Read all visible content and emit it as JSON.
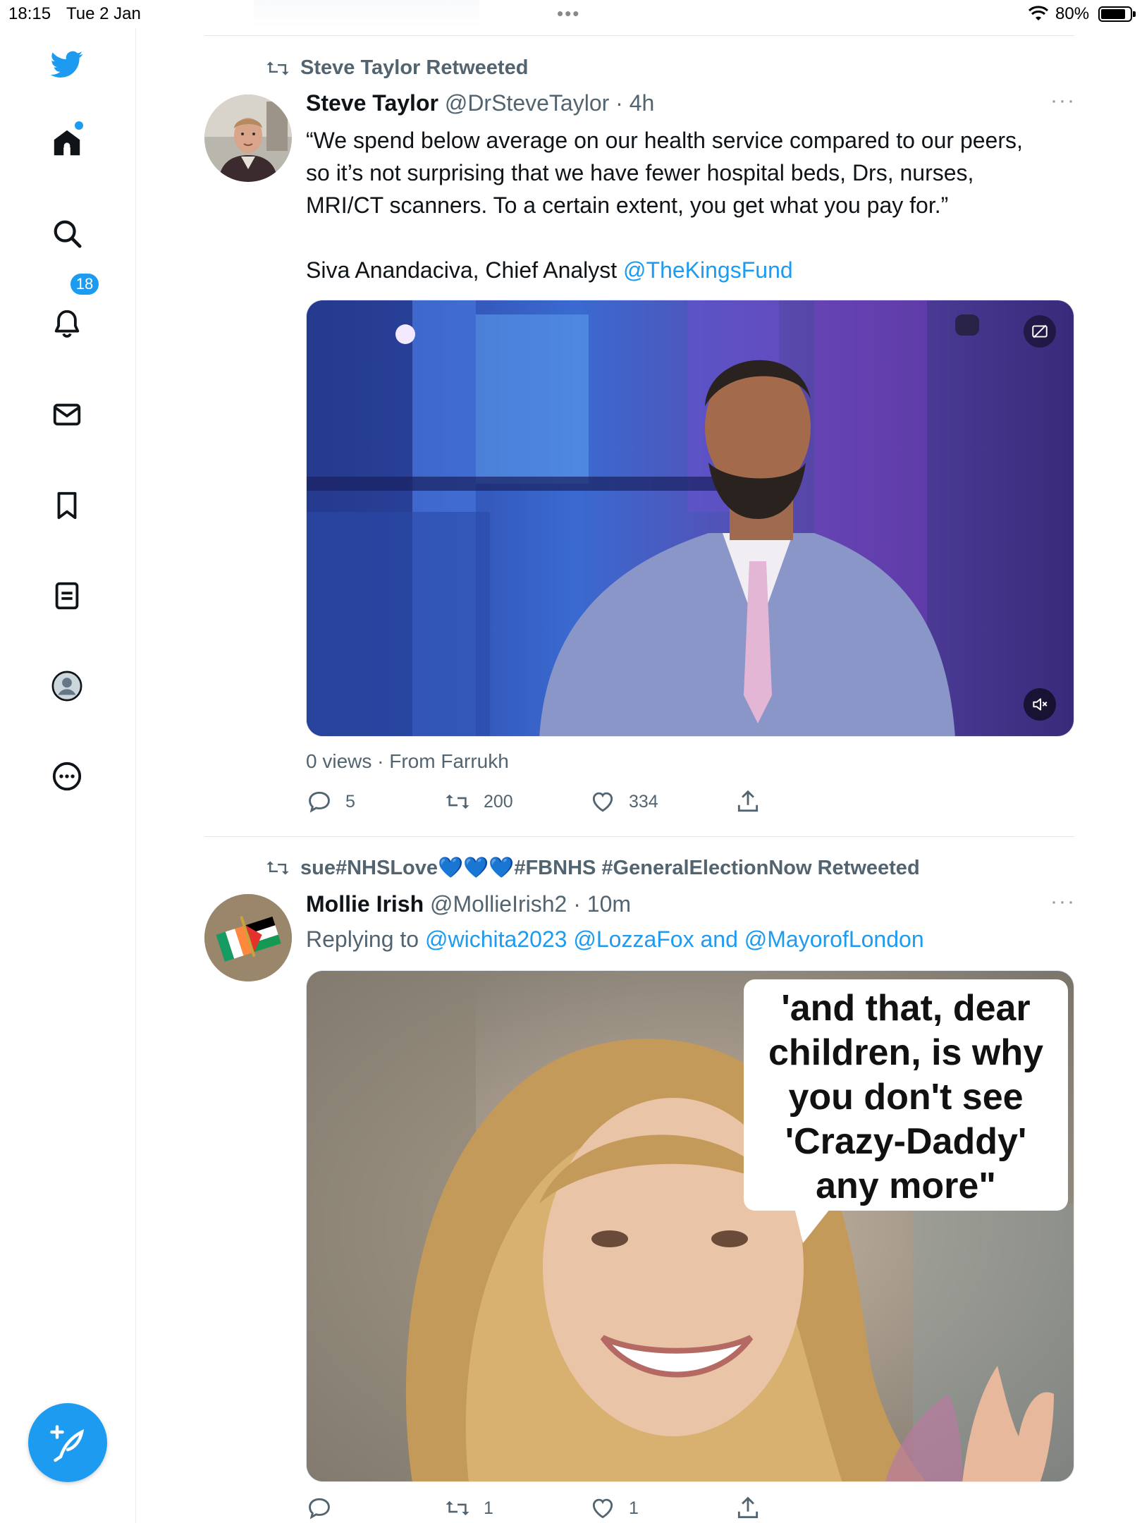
{
  "status_bar": {
    "time": "18:15",
    "date": "Tue 2 Jan",
    "battery": "80%",
    "battery_level": 0.8
  },
  "sidebar": {
    "items": [
      {
        "icon": "twitter-bird-icon"
      },
      {
        "icon": "home-icon"
      },
      {
        "icon": "search-icon"
      },
      {
        "icon": "notifications-bell-icon",
        "badge": "18"
      },
      {
        "icon": "messages-envelope-icon"
      },
      {
        "icon": "bookmark-icon"
      },
      {
        "icon": "lists-icon"
      },
      {
        "icon": "profile-icon"
      },
      {
        "icon": "more-circle-icon"
      }
    ],
    "compose_icon": "compose-feather-icon"
  },
  "tweets": [
    {
      "retweeted_by": "Steve Taylor Retweeted",
      "name": "Steve Taylor",
      "handle": "@DrSteveTaylor",
      "time": "· 4h",
      "text_lines": [
        "“We spend below average on our health service compared to our peers,",
        "so it’s not surprising that we have fewer hospital beds, Drs, nurses,",
        "MRI/CT scanners. To a certain extent, you get what you pay for.”"
      ],
      "text_attribution": "Siva Anandaciva, Chief Analyst ",
      "text_mention": "@TheKingsFund",
      "views": "0 views · From Farrukh",
      "replies": "5",
      "retweets": "200",
      "likes": "334"
    },
    {
      "retweeted_by": "sue#NHSLove💙💙💙#FBNHS #GeneralElectionNow Retweeted",
      "name": "Mollie Irish",
      "handle": "@MollieIrish2",
      "time": "· 10m",
      "replying_prefix": "Replying to ",
      "replying_mention_1": "@wichita2023",
      "replying_mention_2": "@LozzaFox",
      "replying_and": " and ",
      "replying_mention_3": "@MayorofLondon",
      "image_caption_lines": [
        "'and that, dear",
        "children, is why",
        "you don't see",
        "'Crazy-Daddy'",
        "any more\""
      ],
      "replies": "",
      "retweets": "1",
      "likes": "1"
    }
  ],
  "colors": {
    "accent": "#1d9bf0",
    "secondary_text": "#536471",
    "divider": "#e1e8ed"
  }
}
